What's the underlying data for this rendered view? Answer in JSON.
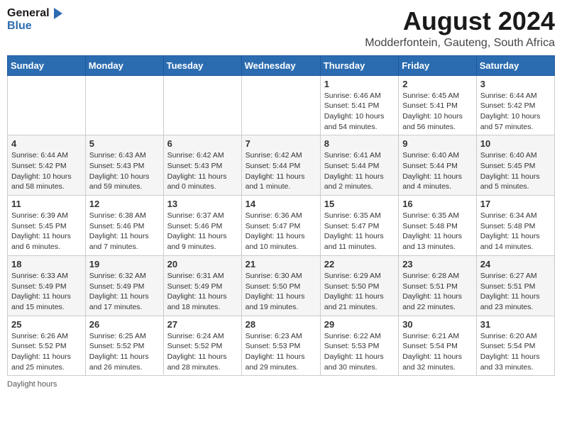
{
  "header": {
    "logo_line1": "General",
    "logo_line2": "Blue",
    "month_title": "August 2024",
    "location": "Modderfontein, Gauteng, South Africa"
  },
  "days_of_week": [
    "Sunday",
    "Monday",
    "Tuesday",
    "Wednesday",
    "Thursday",
    "Friday",
    "Saturday"
  ],
  "weeks": [
    [
      {
        "day": "",
        "info": ""
      },
      {
        "day": "",
        "info": ""
      },
      {
        "day": "",
        "info": ""
      },
      {
        "day": "",
        "info": ""
      },
      {
        "day": "1",
        "info": "Sunrise: 6:46 AM\nSunset: 5:41 PM\nDaylight: 10 hours and 54 minutes."
      },
      {
        "day": "2",
        "info": "Sunrise: 6:45 AM\nSunset: 5:41 PM\nDaylight: 10 hours and 56 minutes."
      },
      {
        "day": "3",
        "info": "Sunrise: 6:44 AM\nSunset: 5:42 PM\nDaylight: 10 hours and 57 minutes."
      }
    ],
    [
      {
        "day": "4",
        "info": "Sunrise: 6:44 AM\nSunset: 5:42 PM\nDaylight: 10 hours and 58 minutes."
      },
      {
        "day": "5",
        "info": "Sunrise: 6:43 AM\nSunset: 5:43 PM\nDaylight: 10 hours and 59 minutes."
      },
      {
        "day": "6",
        "info": "Sunrise: 6:42 AM\nSunset: 5:43 PM\nDaylight: 11 hours and 0 minutes."
      },
      {
        "day": "7",
        "info": "Sunrise: 6:42 AM\nSunset: 5:44 PM\nDaylight: 11 hours and 1 minute."
      },
      {
        "day": "8",
        "info": "Sunrise: 6:41 AM\nSunset: 5:44 PM\nDaylight: 11 hours and 2 minutes."
      },
      {
        "day": "9",
        "info": "Sunrise: 6:40 AM\nSunset: 5:44 PM\nDaylight: 11 hours and 4 minutes."
      },
      {
        "day": "10",
        "info": "Sunrise: 6:40 AM\nSunset: 5:45 PM\nDaylight: 11 hours and 5 minutes."
      }
    ],
    [
      {
        "day": "11",
        "info": "Sunrise: 6:39 AM\nSunset: 5:45 PM\nDaylight: 11 hours and 6 minutes."
      },
      {
        "day": "12",
        "info": "Sunrise: 6:38 AM\nSunset: 5:46 PM\nDaylight: 11 hours and 7 minutes."
      },
      {
        "day": "13",
        "info": "Sunrise: 6:37 AM\nSunset: 5:46 PM\nDaylight: 11 hours and 9 minutes."
      },
      {
        "day": "14",
        "info": "Sunrise: 6:36 AM\nSunset: 5:47 PM\nDaylight: 11 hours and 10 minutes."
      },
      {
        "day": "15",
        "info": "Sunrise: 6:35 AM\nSunset: 5:47 PM\nDaylight: 11 hours and 11 minutes."
      },
      {
        "day": "16",
        "info": "Sunrise: 6:35 AM\nSunset: 5:48 PM\nDaylight: 11 hours and 13 minutes."
      },
      {
        "day": "17",
        "info": "Sunrise: 6:34 AM\nSunset: 5:48 PM\nDaylight: 11 hours and 14 minutes."
      }
    ],
    [
      {
        "day": "18",
        "info": "Sunrise: 6:33 AM\nSunset: 5:49 PM\nDaylight: 11 hours and 15 minutes."
      },
      {
        "day": "19",
        "info": "Sunrise: 6:32 AM\nSunset: 5:49 PM\nDaylight: 11 hours and 17 minutes."
      },
      {
        "day": "20",
        "info": "Sunrise: 6:31 AM\nSunset: 5:49 PM\nDaylight: 11 hours and 18 minutes."
      },
      {
        "day": "21",
        "info": "Sunrise: 6:30 AM\nSunset: 5:50 PM\nDaylight: 11 hours and 19 minutes."
      },
      {
        "day": "22",
        "info": "Sunrise: 6:29 AM\nSunset: 5:50 PM\nDaylight: 11 hours and 21 minutes."
      },
      {
        "day": "23",
        "info": "Sunrise: 6:28 AM\nSunset: 5:51 PM\nDaylight: 11 hours and 22 minutes."
      },
      {
        "day": "24",
        "info": "Sunrise: 6:27 AM\nSunset: 5:51 PM\nDaylight: 11 hours and 23 minutes."
      }
    ],
    [
      {
        "day": "25",
        "info": "Sunrise: 6:26 AM\nSunset: 5:52 PM\nDaylight: 11 hours and 25 minutes."
      },
      {
        "day": "26",
        "info": "Sunrise: 6:25 AM\nSunset: 5:52 PM\nDaylight: 11 hours and 26 minutes."
      },
      {
        "day": "27",
        "info": "Sunrise: 6:24 AM\nSunset: 5:52 PM\nDaylight: 11 hours and 28 minutes."
      },
      {
        "day": "28",
        "info": "Sunrise: 6:23 AM\nSunset: 5:53 PM\nDaylight: 11 hours and 29 minutes."
      },
      {
        "day": "29",
        "info": "Sunrise: 6:22 AM\nSunset: 5:53 PM\nDaylight: 11 hours and 30 minutes."
      },
      {
        "day": "30",
        "info": "Sunrise: 6:21 AM\nSunset: 5:54 PM\nDaylight: 11 hours and 32 minutes."
      },
      {
        "day": "31",
        "info": "Sunrise: 6:20 AM\nSunset: 5:54 PM\nDaylight: 11 hours and 33 minutes."
      }
    ]
  ],
  "footer": {
    "daylight_label": "Daylight hours"
  }
}
